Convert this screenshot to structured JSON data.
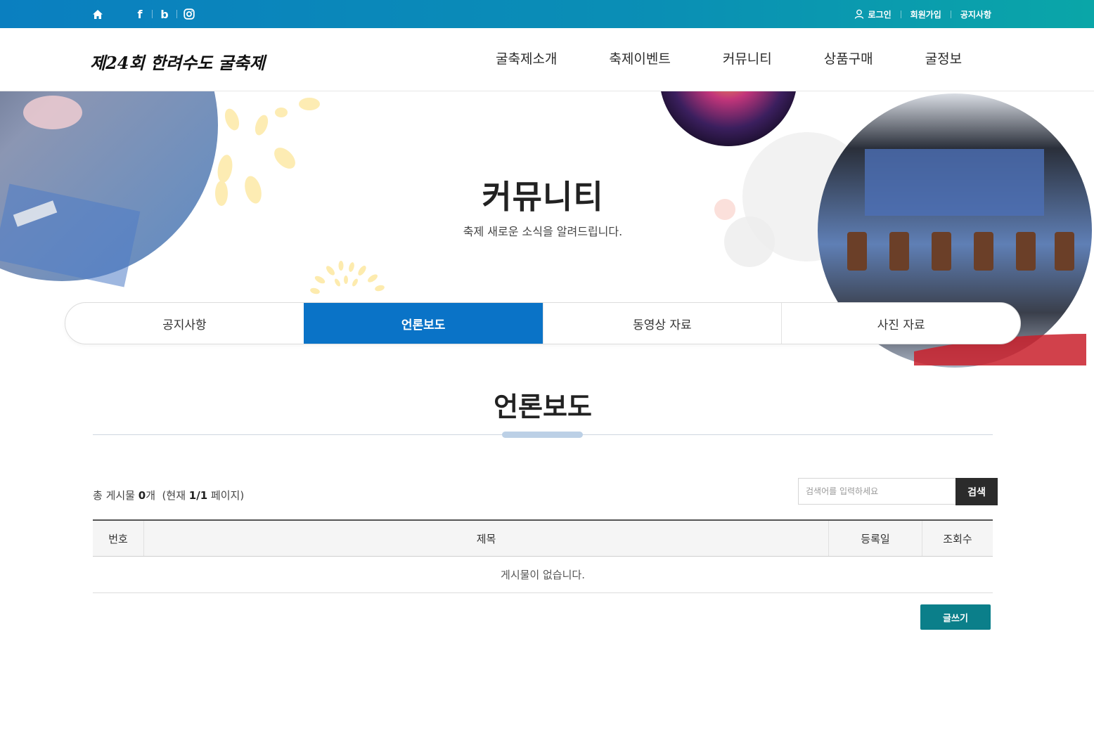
{
  "topbar": {
    "social": [
      {
        "name": "home-icon"
      },
      {
        "name": "facebook-icon",
        "glyph": "f"
      },
      {
        "name": "blog-icon",
        "glyph": "b"
      },
      {
        "name": "instagram-icon"
      }
    ],
    "links": {
      "login": "로그인",
      "join": "회원가입",
      "notice": "공지사항"
    },
    "colors": {
      "start": "#0a7fc0",
      "end": "#0aa6a8"
    }
  },
  "header": {
    "logo_text": "제24회 한려수도 굴축제",
    "nav": [
      "굴축제소개",
      "축제이벤트",
      "커뮤니티",
      "상품구매",
      "굴정보"
    ]
  },
  "hero": {
    "title": "커뮤니티",
    "subtitle": "축제 새로운 소식을 알려드립니다."
  },
  "tabs": {
    "items": [
      "공지사항",
      "언론보도",
      "동영상 자료",
      "사진 자료"
    ],
    "active": "언론보도",
    "active_color": "#0a73c7"
  },
  "section": {
    "title": "언론보도"
  },
  "board": {
    "count_prefix": "총 게시물",
    "count": "0",
    "count_unit": "개",
    "page_info_prefix": "(현재",
    "page_info": "1/1",
    "page_info_suffix": "페이지)",
    "search_placeholder": "검색어를 입력하세요",
    "search_button": "검색",
    "columns": [
      "번호",
      "제목",
      "등록일",
      "조회수"
    ],
    "empty_message": "게시물이 없습니다.",
    "write_button": "글쓰기",
    "write_color": "#0b7f8a"
  }
}
